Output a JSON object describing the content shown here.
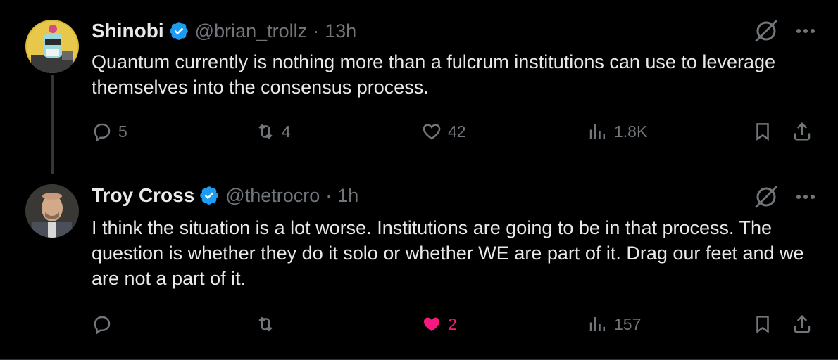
{
  "tweets": [
    {
      "name": "Shinobi",
      "handle": "@brian_trollz",
      "time": "13h",
      "text": "Quantum currently is nothing more than a fulcrum institutions can use to leverage themselves into the consensus process.",
      "replies": "5",
      "retweets": "4",
      "likes": "42",
      "views": "1.8K",
      "liked": false
    },
    {
      "name": "Troy Cross",
      "handle": "@thetrocro",
      "time": "1h",
      "text": "I think the situation is a lot worse. Institutions are going to be in that process. The question is whether they do it solo or whether WE are part of it. Drag our feet and we are not a part of it.",
      "replies": "",
      "retweets": "",
      "likes": "2",
      "views": "157",
      "liked": true
    }
  ],
  "separator": "·",
  "colors": {
    "background": "#000000",
    "text": "#e7e9ea",
    "muted": "#71767b",
    "verified": "#1d9bf0",
    "like": "#f91880"
  },
  "icons": [
    "verified-badge-icon",
    "grok-icon",
    "more-icon",
    "reply-icon",
    "retweet-icon",
    "like-icon",
    "views-icon",
    "bookmark-icon",
    "share-icon"
  ]
}
